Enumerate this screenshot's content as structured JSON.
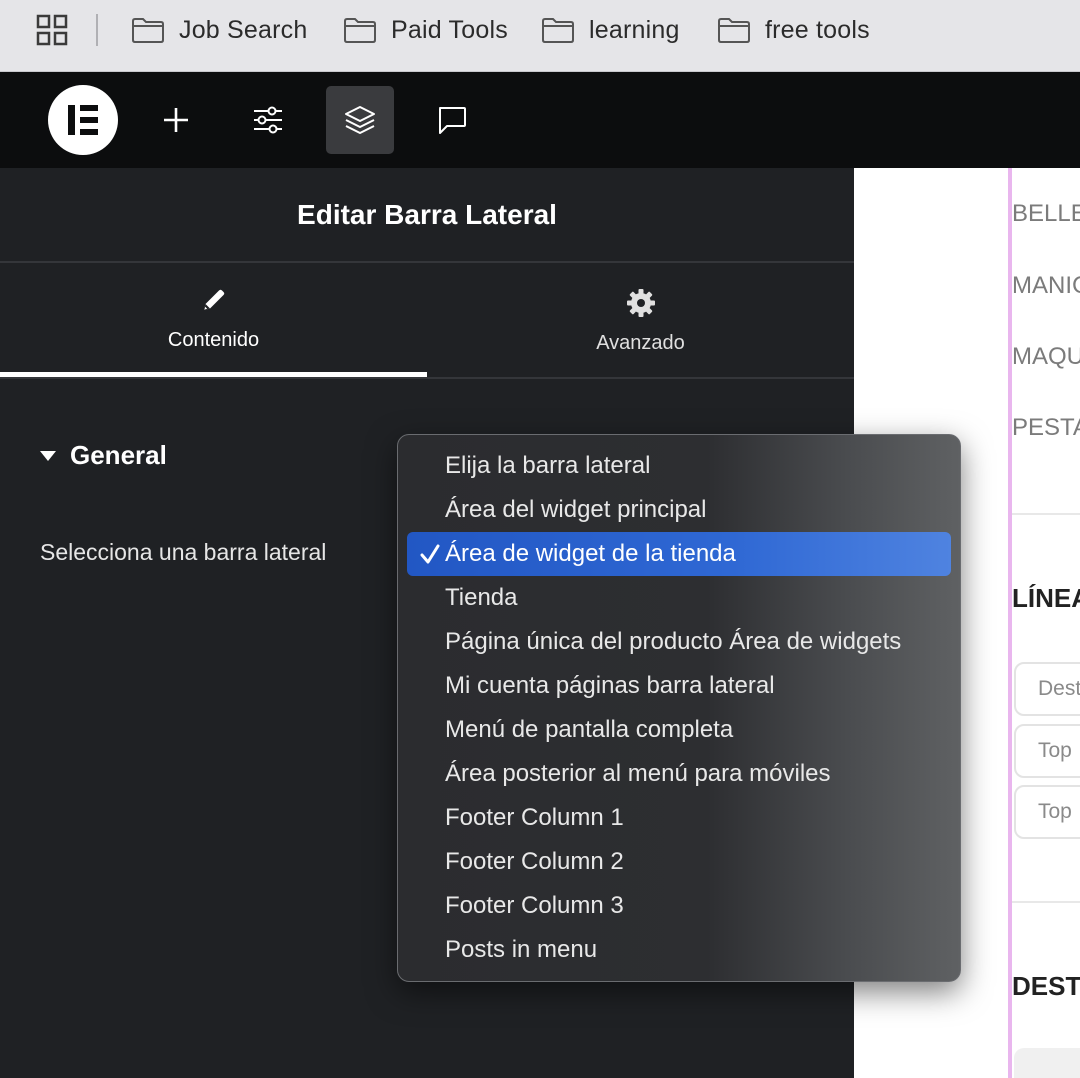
{
  "bookmarks": {
    "items": [
      {
        "label": "Job Search"
      },
      {
        "label": "Paid Tools"
      },
      {
        "label": "learning"
      },
      {
        "label": "free tools"
      }
    ]
  },
  "toolbar": {
    "icons": [
      "elementor-logo-icon",
      "add-icon",
      "sliders-icon",
      "layers-icon",
      "comments-icon"
    ],
    "active": "layers-icon"
  },
  "panel": {
    "title": "Editar Barra Lateral",
    "tabs": [
      {
        "label": "Contenido",
        "icon": "pencil-icon",
        "active": true
      },
      {
        "label": "Avanzado",
        "icon": "gear-icon",
        "active": false
      }
    ],
    "section": {
      "title": "General"
    },
    "control": {
      "label": "Selecciona una barra lateral"
    }
  },
  "dropdown": {
    "selected_index": 2,
    "options": [
      "Elija la barra lateral",
      "Área del widget principal",
      "Área de widget de la tienda",
      "Tienda",
      "Página única del producto Área de widgets",
      "Mi cuenta páginas barra lateral",
      "Menú de pantalla completa",
      "Área posterior al menú para móviles",
      "Footer Column 1",
      "Footer Column 2",
      "Footer Column 3",
      "Posts in menu"
    ]
  },
  "preview": {
    "menu_items": [
      "BELLE",
      "MANIC",
      "MAQU",
      "PESTA"
    ],
    "heading_1": "LÍNEA",
    "chips": [
      "Dest",
      "Top",
      "Top"
    ],
    "heading_2": "DEST"
  },
  "colors": {
    "panel_bg": "#1f2124",
    "topbar_bg": "#0c0d0e",
    "selected_bg": "#2f68d4",
    "preview_accent": "#e9b6ee"
  }
}
